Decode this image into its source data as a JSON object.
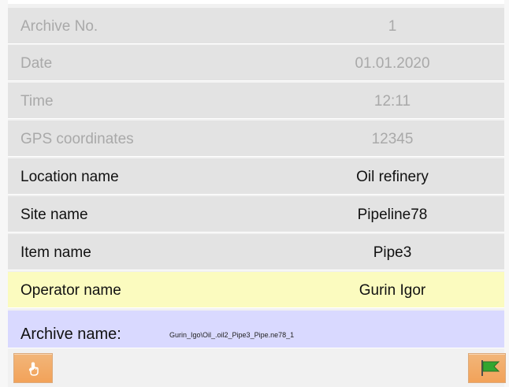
{
  "rows": [
    {
      "label": "Archive No.",
      "value": "1"
    },
    {
      "label": "Date",
      "value": "01.01.2020"
    },
    {
      "label": "Time",
      "value": "12:11"
    },
    {
      "label": "GPS coordinates",
      "value": "12345"
    },
    {
      "label": "Location name",
      "value": "Oil refinery"
    },
    {
      "label": "Site name",
      "value": "Pipeline78"
    },
    {
      "label": "Item name",
      "value": "Pipe3"
    },
    {
      "label": "Operator name",
      "value": "Gurin Igor"
    }
  ],
  "archive": {
    "label": "Archive name:",
    "value": "Gurin_Igo\\Oil_.oil2_Pipe3_Pipe.ne78_1"
  },
  "icons": {
    "left_button": "hand-pointer-icon",
    "right_button": "flag-icon"
  },
  "colors": {
    "row_background": "#e3e3e3",
    "disabled_text": "#a9a9a9",
    "highlight_row": "#fbfbbf",
    "archive_row": "#d9d9ff",
    "button_orange": "#f2a259",
    "flag_green": "#32a62f"
  }
}
